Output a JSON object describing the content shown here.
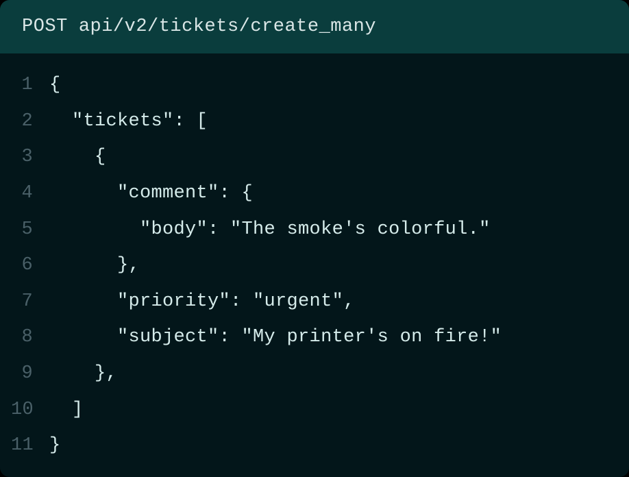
{
  "header": {
    "method": "POST",
    "endpoint": "api/v2/tickets/create_many"
  },
  "code": {
    "lines": [
      {
        "num": "1",
        "text": "{"
      },
      {
        "num": "2",
        "text": "  \"tickets\": ["
      },
      {
        "num": "3",
        "text": "    {"
      },
      {
        "num": "4",
        "text": "      \"comment\": {"
      },
      {
        "num": "5",
        "text": "        \"body\": \"The smoke's colorful.\""
      },
      {
        "num": "6",
        "text": "      },"
      },
      {
        "num": "7",
        "text": "      \"priority\": \"urgent\","
      },
      {
        "num": "8",
        "text": "      \"subject\": \"My printer's on fire!\""
      },
      {
        "num": "9",
        "text": "    },"
      },
      {
        "num": "10",
        "text": "  ]"
      },
      {
        "num": "11",
        "text": "}"
      }
    ]
  }
}
